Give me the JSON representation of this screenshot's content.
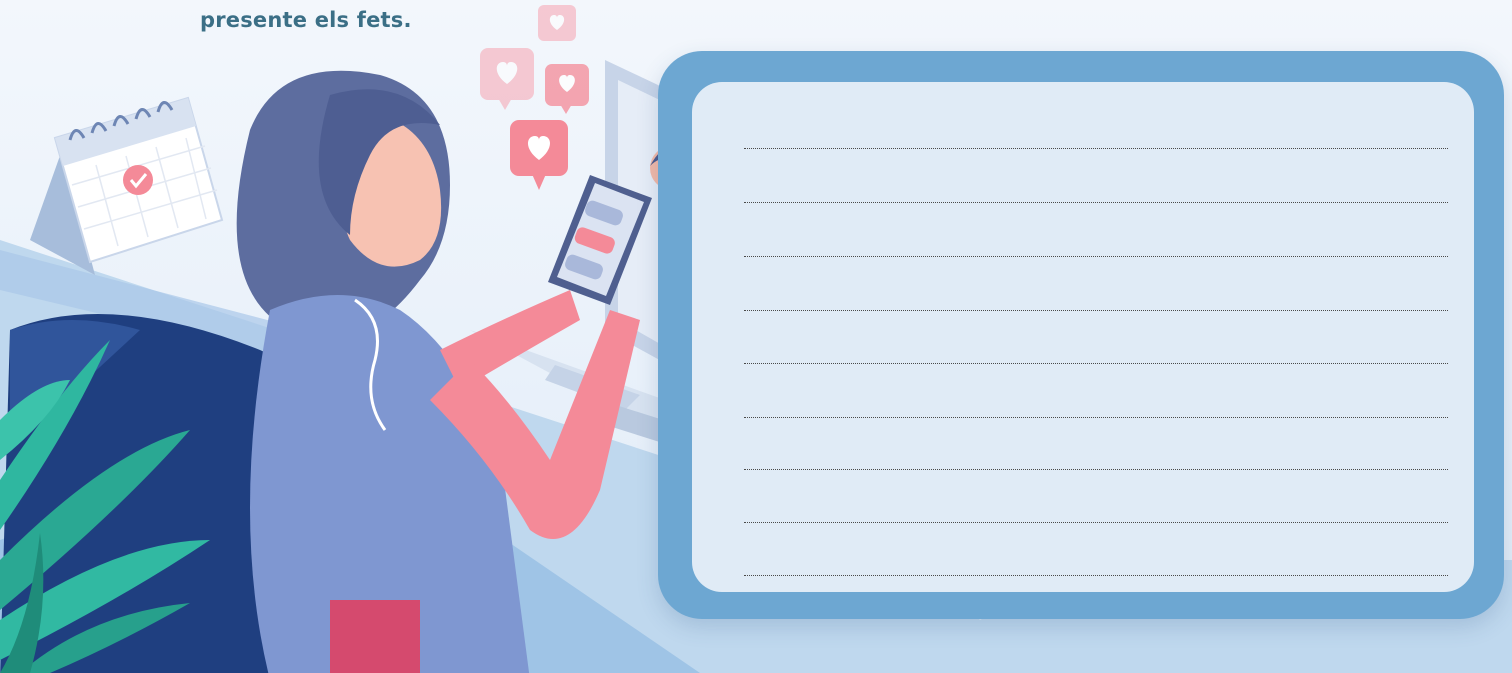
{
  "prompt": {
    "text": "presente els fets."
  },
  "answer_box": {
    "line_count": 9
  },
  "illustration": {
    "icons": [
      "calendar-icon",
      "heart-notification-icon",
      "smartphone-icon",
      "laptop-icon",
      "plant-icon",
      "chair-icon"
    ]
  },
  "colors": {
    "prompt_text": "#3b6f86",
    "frame": "#6da7d2",
    "answer_area": "#ecf3fa",
    "heart_bubble": "#f48a98",
    "plant": "#2fb7a0",
    "chair": "#1f3f80"
  }
}
